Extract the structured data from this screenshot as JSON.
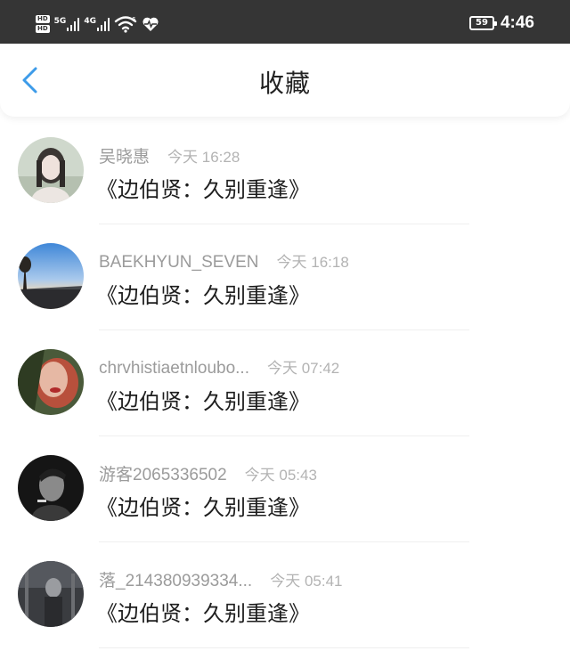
{
  "status_bar": {
    "hd_badge_top": "HD",
    "hd_badge_bottom": "HD",
    "net1": "5G",
    "net2": "4G",
    "wifi_label": "6",
    "battery": "59",
    "time": "4:46"
  },
  "header": {
    "title": "收藏",
    "back_icon": "chevron-left-icon",
    "accent_color": "#3d9be9"
  },
  "items": [
    {
      "user": "吴晓惠",
      "time": "今天 16:28",
      "title": "《边伯贤：久别重逢》"
    },
    {
      "user": "BAEKHYUN_SEVEN",
      "time": "今天 16:18",
      "title": "《边伯贤：久别重逢》"
    },
    {
      "user": "chrvhistiaetnloubo...",
      "time": "今天 07:42",
      "title": "《边伯贤：久别重逢》"
    },
    {
      "user": "游客2065336502",
      "time": "今天 05:43",
      "title": "《边伯贤：久别重逢》"
    },
    {
      "user": "落_214380939334...",
      "time": "今天 05:41",
      "title": "《边伯贤：久别重逢》"
    }
  ]
}
